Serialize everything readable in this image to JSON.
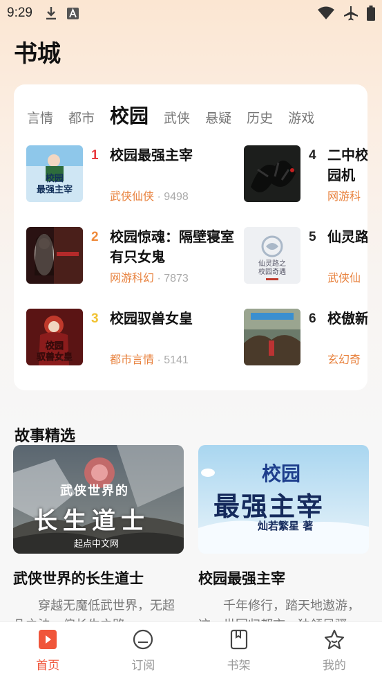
{
  "status_bar": {
    "time": "9:29",
    "left_icons": [
      "download-icon",
      "a-badge-icon"
    ],
    "right_icons": [
      "wifi-icon",
      "airplane-icon",
      "battery-icon"
    ]
  },
  "page_title": "书城",
  "rank_card": {
    "tabs": [
      {
        "label": "言情",
        "active": false
      },
      {
        "label": "都市",
        "active": false
      },
      {
        "label": "校园",
        "active": true
      },
      {
        "label": "武侠",
        "active": false
      },
      {
        "label": "悬疑",
        "active": false
      },
      {
        "label": "历史",
        "active": false
      },
      {
        "label": "游戏",
        "active": false
      }
    ],
    "items": [
      {
        "rank": "1",
        "rank_color": "#e8383d",
        "title": "校园最强主宰",
        "genre": "武侠仙侠",
        "count": "9498"
      },
      {
        "rank": "2",
        "rank_color": "#ef8a3a",
        "title": "校园惊魂：隔壁寝室有只女鬼",
        "genre": "网游科幻",
        "count": "7873"
      },
      {
        "rank": "3",
        "rank_color": "#f1c232",
        "title": "校园驭兽女皇",
        "genre": "都市言情",
        "count": "5141"
      },
      {
        "rank": "4",
        "rank_color": "#222222",
        "title": "二中校园机",
        "genre": "网游科",
        "count": ""
      },
      {
        "rank": "5",
        "rank_color": "#222222",
        "title": "仙灵路",
        "genre": "武侠仙",
        "count": ""
      },
      {
        "rank": "6",
        "rank_color": "#222222",
        "title": "校傲新",
        "genre": "玄幻奇",
        "count": ""
      }
    ],
    "covers": {
      "c1_title": "校园\n最强主宰",
      "c3_title": "校园\n驭兽女皇",
      "c5_title": "仙灵路之\n校园奇遇"
    },
    "meta_separator": " · "
  },
  "stories": {
    "section_title": "故事精选",
    "items": [
      {
        "title": "武侠世界的长生道士",
        "desc": "穿越无魔低武世界，无超凡之法，偏长生之路。",
        "cover_line1": "武侠世界的",
        "cover_line2": "长生道士",
        "cover_publisher": "起点中文网"
      },
      {
        "title": "校园最强主宰",
        "desc": "千年修行，踏天地遨游，这一世回归都市，独领风骚。",
        "cover_line1": "校园",
        "cover_line2": "最强主宰",
        "cover_author": "灿若繁星 著"
      }
    ]
  },
  "bottom_nav": [
    {
      "label": "首页",
      "icon": "home-bookmark-icon",
      "active": true
    },
    {
      "label": "订阅",
      "icon": "subscribe-icon",
      "active": false
    },
    {
      "label": "书架",
      "icon": "bookshelf-icon",
      "active": false
    },
    {
      "label": "我的",
      "icon": "profile-star-icon",
      "active": false
    }
  ],
  "colors": {
    "accent": "#f0553a",
    "genre": "#e8823e",
    "inactive": "#999999"
  }
}
